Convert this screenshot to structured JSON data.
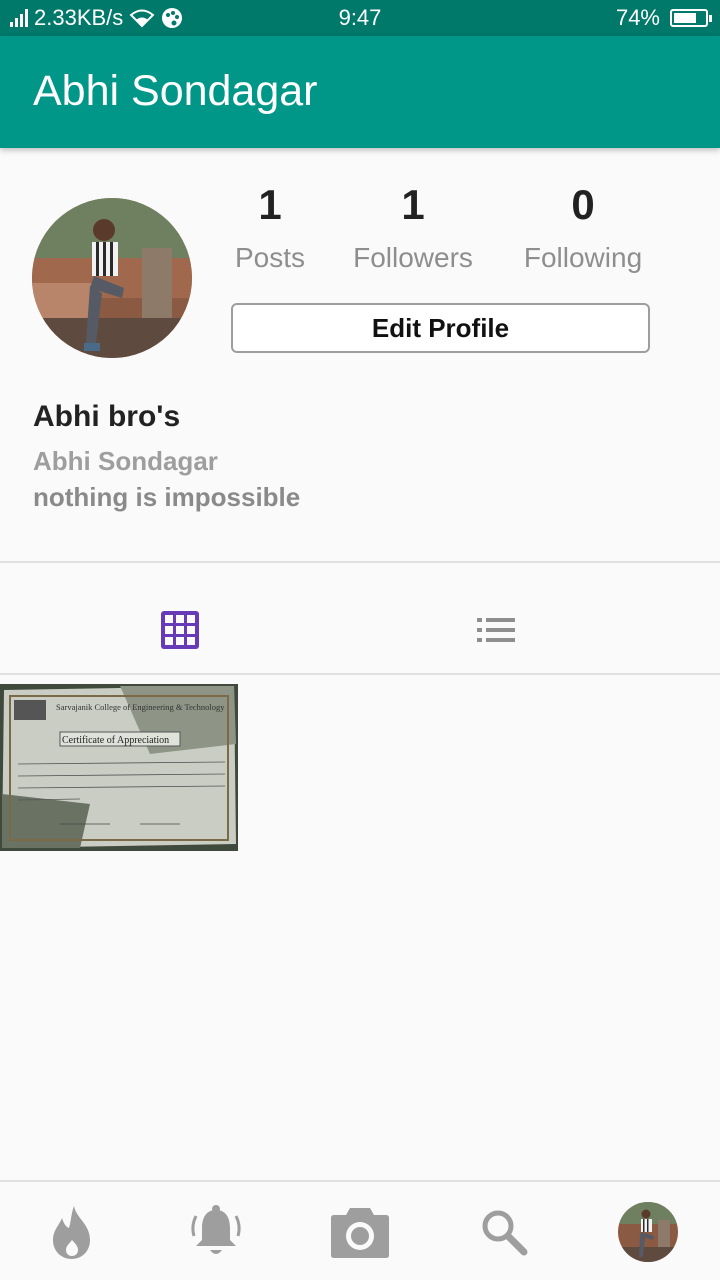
{
  "status_bar": {
    "network_speed": "2.33KB/s",
    "time": "9:47",
    "battery_percent_text": "74%",
    "battery_level": 0.74
  },
  "app_bar": {
    "title": "Abhi Sondagar"
  },
  "profile": {
    "stats": [
      {
        "count": "1",
        "label": "Posts"
      },
      {
        "count": "1",
        "label": "Followers"
      },
      {
        "count": "0",
        "label": "Following"
      }
    ],
    "edit_button_label": "Edit Profile",
    "display_name": "Abhi bro's",
    "username": "Abhi Sondagar",
    "bio": "nothing is impossible"
  },
  "view_tabs": [
    {
      "icon": "grid-icon",
      "active": true
    },
    {
      "icon": "list-icon",
      "active": false
    }
  ],
  "posts": [
    {
      "image": "certificate-photo",
      "text_lines": [
        "Sarvajanik College of Engineering & Technology",
        "Certificate of Appreciation"
      ]
    }
  ],
  "bottom_nav": [
    {
      "icon": "flame-icon"
    },
    {
      "icon": "bell-icon"
    },
    {
      "icon": "camera-icon"
    },
    {
      "icon": "search-icon"
    },
    {
      "icon": "profile-avatar"
    }
  ],
  "colors": {
    "status_bar": "#00796b",
    "app_bar": "#009688",
    "accent": "#673ab7",
    "nav_icon": "#9e9e9e"
  }
}
